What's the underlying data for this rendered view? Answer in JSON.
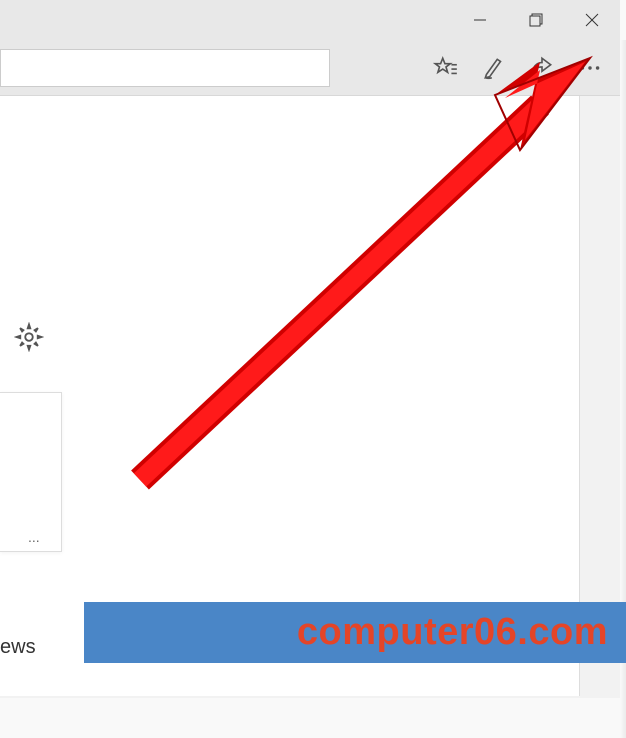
{
  "window_controls": {
    "minimize": "minimize",
    "maximize": "maximize",
    "close": "close"
  },
  "toolbar": {
    "favorites": "favorites",
    "notes": "notes",
    "share": "share",
    "more": "more"
  },
  "address_value": "",
  "settings_label": "settings",
  "card": {
    "ellipsis": "..."
  },
  "partial_text": "ews",
  "watermark": "computer06.com"
}
